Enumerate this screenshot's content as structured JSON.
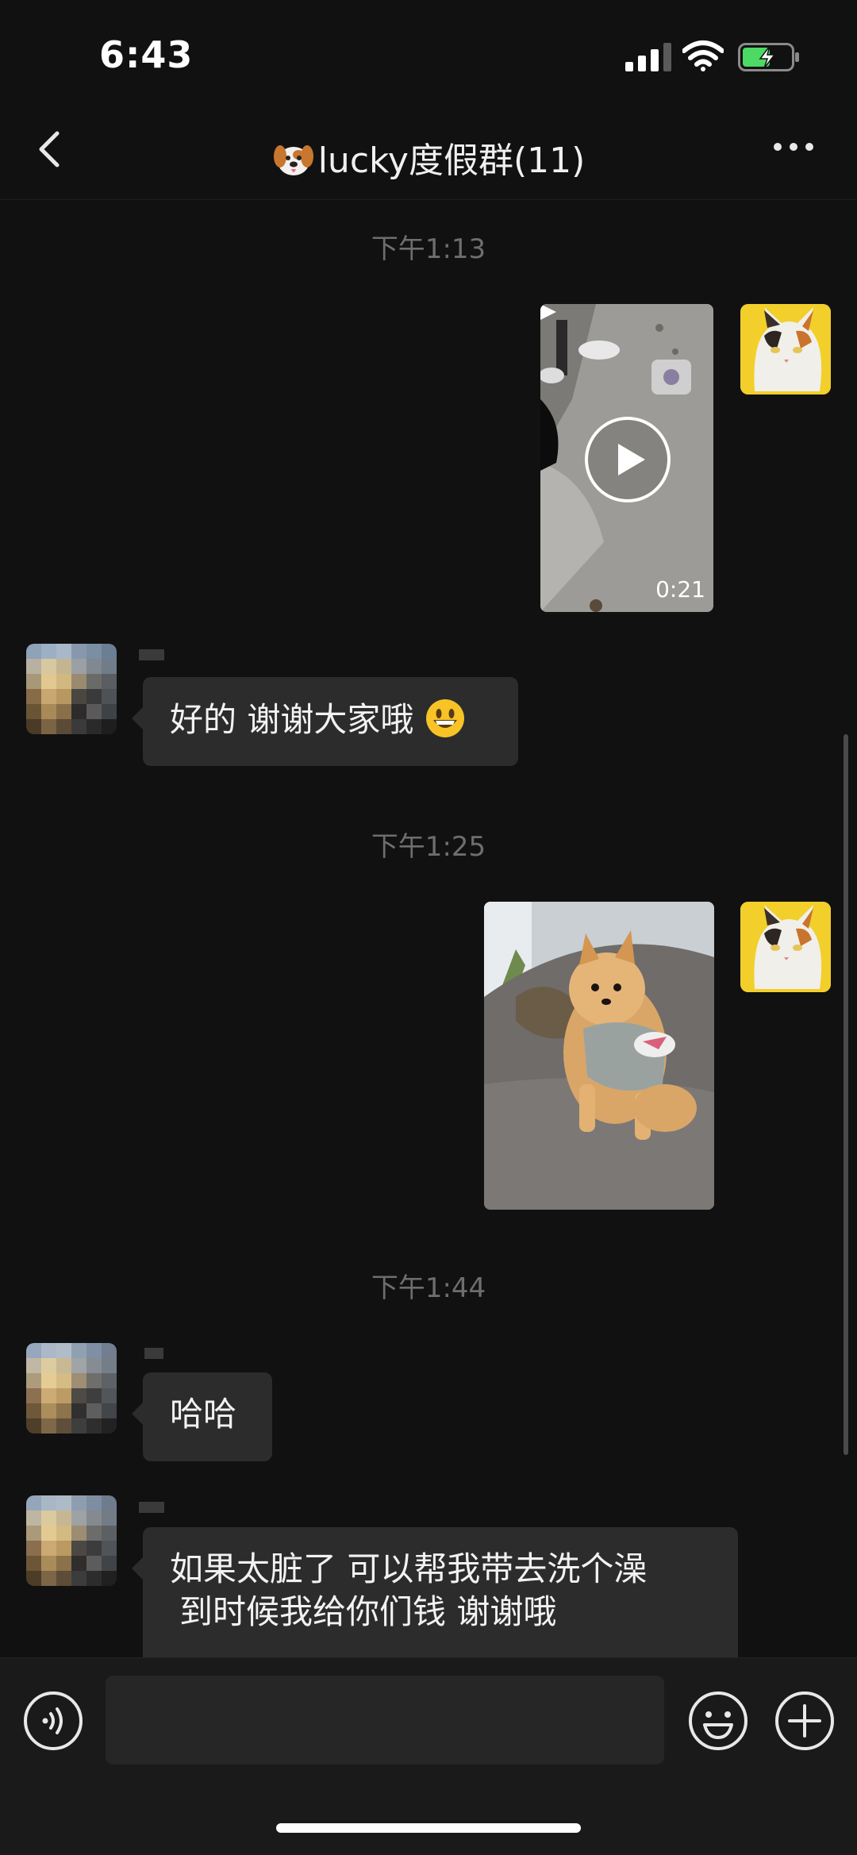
{
  "status_bar": {
    "time": "6:43"
  },
  "nav": {
    "title": "lucky度假群(11)",
    "title_emoji": "puppy-face-icon"
  },
  "messages": {
    "ts1": "下午1:13",
    "video_duration": "0:21",
    "msg1": "好的 谢谢大家哦",
    "msg1_emoji": "grinning-face-icon",
    "ts2": "下午1:25",
    "ts3": "下午1:44",
    "msg2": "哈哈",
    "msg3_line1": "如果太脏了 可以帮我带去洗个澡",
    "msg3_line2": "到时候我给你们钱 谢谢哦"
  },
  "input": {
    "placeholder": ""
  },
  "colors": {
    "background": "#111111",
    "bubble": "#2c2c2c",
    "timestamp": "#6e6e6e",
    "battery": "#4cd964"
  }
}
